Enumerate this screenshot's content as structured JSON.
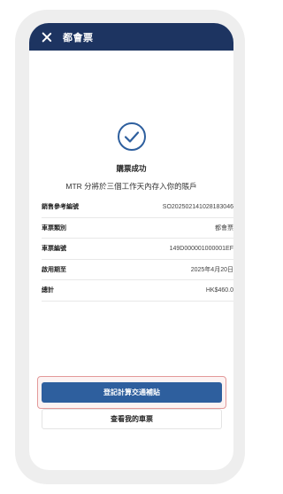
{
  "header": {
    "title": "都會票",
    "close_icon": "close-icon"
  },
  "status": {
    "icon": "check-circle-icon",
    "title": "購票成功",
    "message": "MTR 分將於三個工作天內存入你的賬戶"
  },
  "details": [
    {
      "label": "銷售參考編號",
      "value": "SO202502141028183046"
    },
    {
      "label": "車票類別",
      "value": "都會票"
    },
    {
      "label": "車票編號",
      "value": "149D000001000001EF"
    },
    {
      "label": "啟用期至",
      "value": "2025年4月20日"
    },
    {
      "label": "總計",
      "value": "HK$460.0"
    }
  ],
  "buttons": {
    "primary_label": "登記計算交通補貼",
    "secondary_label": "查看我的車票"
  },
  "colors": {
    "header_bg": "#1d3461",
    "primary_button": "#2e5f9e",
    "check_icon": "#2e5f9e",
    "highlight_border": "#e39a9a"
  }
}
